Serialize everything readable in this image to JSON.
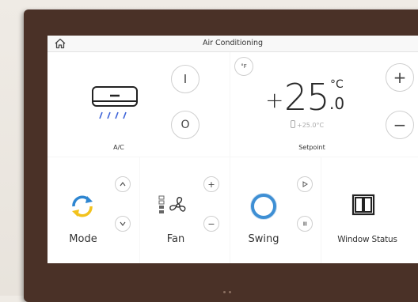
{
  "header": {
    "title": "Air Conditioning"
  },
  "ac": {
    "label": "A/C",
    "on_symbol": "I",
    "off_symbol": "O"
  },
  "setpoint": {
    "unit_toggle": "°F",
    "sign": "+",
    "integer": "25",
    "unit": "°C",
    "decimal": ".0",
    "current_reading": "+25.0°C",
    "label": "Setpoint",
    "plus_symbol": "+",
    "minus_symbol": "−"
  },
  "mode": {
    "label": "Mode"
  },
  "fan": {
    "label": "Fan",
    "plus_symbol": "+",
    "minus_symbol": "−"
  },
  "swing": {
    "label": "Swing"
  },
  "window": {
    "label": "Window Status"
  },
  "icons": [
    "home-icon",
    "air-conditioner-icon",
    "power-on-icon",
    "power-off-icon",
    "mode-cycle-icon",
    "chevron-up-icon",
    "chevron-down-icon",
    "fan-icon",
    "fan-level-icon",
    "swing-icon",
    "play-icon",
    "pause-icon",
    "window-icon",
    "thermometer-icon"
  ],
  "colors": {
    "bezel": "#4a3127",
    "swing_ring": "#3e8fd4",
    "mode_blue": "#2e86d1",
    "mode_yellow": "#f2c21c"
  }
}
